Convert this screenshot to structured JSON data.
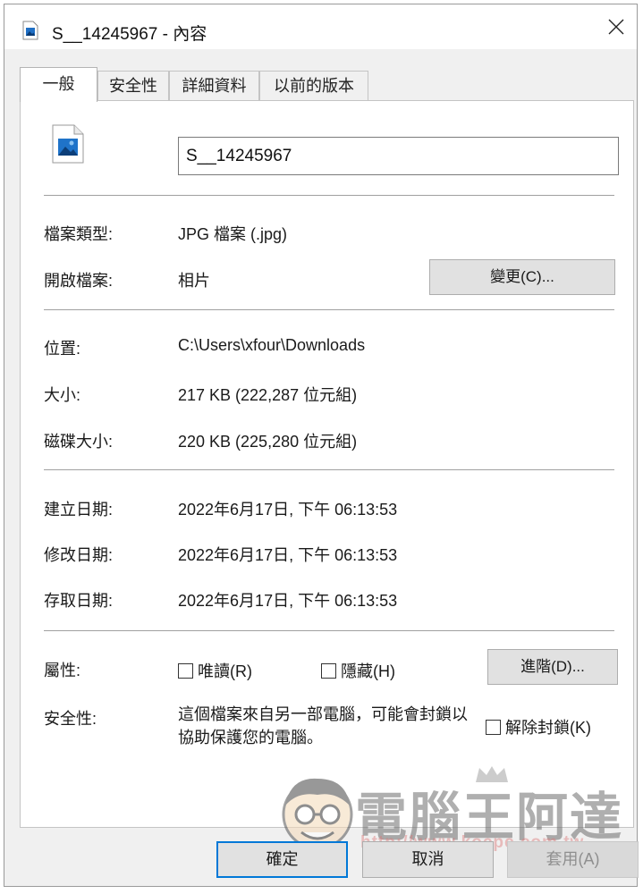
{
  "window": {
    "title": "S__14245967 - 內容"
  },
  "tabs": [
    {
      "label": "一般",
      "active": true
    },
    {
      "label": "安全性",
      "active": false
    },
    {
      "label": "詳細資料",
      "active": false
    },
    {
      "label": "以前的版本",
      "active": false
    }
  ],
  "general": {
    "file_name": "S__14245967",
    "file_type_label": "檔案類型:",
    "file_type_value": "JPG 檔案 (.jpg)",
    "opens_with_label": "開啟檔案:",
    "opens_with_value": "相片",
    "change_button": "變更(C)...",
    "location_label": "位置:",
    "location_value": "C:\\Users\\xfour\\Downloads",
    "size_label": "大小:",
    "size_value": "217 KB (222,287 位元組)",
    "size_on_disk_label": "磁碟大小:",
    "size_on_disk_value": "220 KB (225,280 位元組)",
    "created_label": "建立日期:",
    "created_value": "2022年6月17日, 下午 06:13:53",
    "modified_label": "修改日期:",
    "modified_value": "2022年6月17日, 下午 06:13:53",
    "accessed_label": "存取日期:",
    "accessed_value": "2022年6月17日, 下午 06:13:53",
    "attributes_label": "屬性:",
    "readonly_label": "唯讀(R)",
    "hidden_label": "隱藏(H)",
    "advanced_button": "進階(D)...",
    "security_label": "安全性:",
    "security_text": "這個檔案來自另一部電腦，可能會封鎖以協助保護您的電腦。",
    "unblock_label": "解除封鎖(K)"
  },
  "watermark": {
    "title": "電腦王阿達",
    "url": "http://www.kocpc.com.tw"
  },
  "buttons": {
    "ok": "確定",
    "cancel": "取消",
    "apply": "套用(A)"
  },
  "colors": {
    "accent": "#0078d7",
    "window_bg": "#f0f0f0"
  },
  "icons": {
    "title": "image-file-icon",
    "close": "close-icon",
    "file": "photo-file-icon"
  }
}
